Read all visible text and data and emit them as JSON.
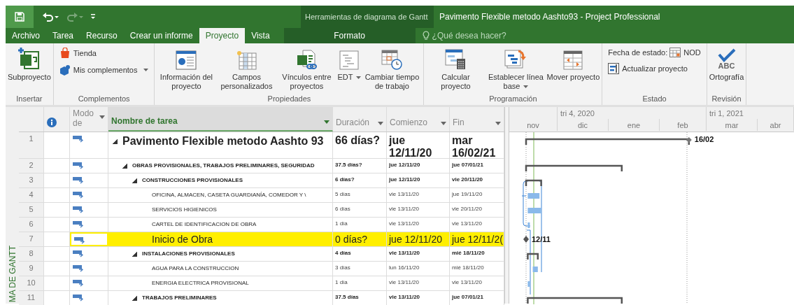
{
  "quick_access": [
    {
      "kind": "save",
      "disabled": false
    },
    {
      "kind": "undo",
      "disabled": false
    },
    {
      "kind": "redo",
      "disabled": true
    },
    {
      "kind": "customize",
      "disabled": false
    }
  ],
  "context_title": "Herramientas de diagrama de Gantt",
  "window": {
    "title": "Pavimento Flexible metodo Aashto93 - Project Professional"
  },
  "tabs": [
    {
      "label": "Archivo",
      "selected": false
    },
    {
      "label": "Tarea",
      "selected": false
    },
    {
      "label": "Recurso",
      "selected": false
    },
    {
      "label": "Crear un informe",
      "selected": false
    },
    {
      "label": "Proyecto",
      "selected": true
    },
    {
      "label": "Vista",
      "selected": false
    },
    {
      "label": "Formato",
      "selected": false,
      "kind": "contextual"
    }
  ],
  "tell_me": {
    "placeholder": "¿Qué desea hacer?"
  },
  "ribbon_groups": [
    {
      "label": "Insertar",
      "buttons": [
        {
          "kind": "large",
          "label": "Subproyecto"
        }
      ]
    },
    {
      "label": "Complementos",
      "buttons": [
        {
          "kind": "small",
          "label": "Tienda"
        },
        {
          "kind": "small",
          "label": "Mis complementos",
          "dropdown": true
        }
      ]
    },
    {
      "label": "Propiedades",
      "buttons": [
        {
          "kind": "large",
          "label": "Información del proyecto"
        },
        {
          "kind": "large",
          "label": "Campos personalizados"
        },
        {
          "kind": "large",
          "label": "Vínculos entre proyectos"
        },
        {
          "kind": "large",
          "label": "EDT",
          "dropdown": true
        },
        {
          "kind": "large",
          "label": "Cambiar tiempo de trabajo"
        }
      ]
    },
    {
      "label": "Programación",
      "buttons": [
        {
          "kind": "large",
          "label": "Calcular proyecto"
        },
        {
          "kind": "large",
          "label": "Establecer línea base",
          "dropdown": true
        },
        {
          "kind": "large",
          "label": "Mover proyecto"
        }
      ]
    },
    {
      "label": "Estado",
      "buttons": [
        {
          "kind": "status",
          "label": "Fecha de estado:",
          "value": "NOD"
        },
        {
          "kind": "small",
          "label": "Actualizar proyecto"
        }
      ]
    },
    {
      "label": "Revisión",
      "buttons": [
        {
          "kind": "large",
          "label": "Ortografía",
          "icon_text": "ABC"
        }
      ]
    }
  ],
  "side_label": "MA DE GANTT",
  "table": {
    "columns": [
      "Modo de",
      "Nombre de tarea",
      "Duración",
      "Comienzo",
      "Fin"
    ],
    "rows": [
      {
        "number": "1",
        "kind": "project",
        "name": "Pavimento Flexible metodo Aashto 93",
        "duration": "66 días?",
        "start": "jue 12/11/20",
        "finish": "mar 16/02/21",
        "highlight": false,
        "expanded": true,
        "bar_label": "16/02",
        "children": [
          {
            "number": "2",
            "kind": "summary",
            "name": "OBRAS PROVISIONALES, TRABAJOS PRELIMINARES, SEGURIDAD",
            "duration": "37.5 días?",
            "start": "jue 12/11/20",
            "finish": "jue 07/01/21",
            "highlight": false,
            "expanded": true,
            "children": [
              {
                "number": "3",
                "kind": "summary",
                "name": "CONSTRUCCIONES PROVISIONALES",
                "duration": "6 días?",
                "start": "jue 12/11/20",
                "finish": "vie 20/11/20",
                "highlight": false,
                "expanded": true,
                "children": [
                  {
                    "number": "4",
                    "kind": "task",
                    "name": "OFICINA, ALMACEN, CASETA GUARDIANÍA, COMEDOR Y \\",
                    "duration": "5 días",
                    "start": "vie 13/11/20",
                    "finish": "jue 19/11/20",
                    "highlight": false
                  },
                  {
                    "number": "5",
                    "kind": "task",
                    "name": "SERVICIOS HIGIENICOS",
                    "duration": "6 días",
                    "start": "vie 13/11/20",
                    "finish": "vie 20/11/20",
                    "highlight": false
                  },
                  {
                    "number": "6",
                    "kind": "task",
                    "name": "CARTEL DE IDENTIFICACION DE OBRA",
                    "duration": "1 día",
                    "start": "vie 13/11/20",
                    "finish": "vie 13/11/20",
                    "highlight": false
                  },
                  {
                    "number": "7",
                    "kind": "milestone",
                    "name": "Inicio de Obra",
                    "duration": "0 días?",
                    "start": "jue 12/11/20",
                    "finish": "jue 12/11/2(",
                    "highlight": true,
                    "bar_label": "12/11"
                  }
                ]
              },
              {
                "number": "8",
                "kind": "summary",
                "name": "INSTALACIONES PROVISIONALES",
                "duration": "4 días",
                "start": "vie 13/11/20",
                "finish": "mié 18/11/20",
                "highlight": false,
                "expanded": true,
                "children": [
                  {
                    "number": "9",
                    "kind": "task",
                    "name": "AGUA PARA LA CONSTRUCCION",
                    "duration": "3 días",
                    "start": "lun 16/11/20",
                    "finish": "mié 18/11/20",
                    "highlight": false
                  },
                  {
                    "number": "10",
                    "kind": "task",
                    "name": "ENERGIA ELECTRICA PROVISIONAL",
                    "duration": "1 día",
                    "start": "vie 13/11/20",
                    "finish": "vie 13/11/20",
                    "highlight": false
                  }
                ]
              },
              {
                "number": "11",
                "kind": "summary",
                "name": "TRABAJOS PRELIMINARES",
                "duration": "37.5 días",
                "start": "vie 13/11/20",
                "finish": "jue 07/01/21",
                "highlight": false,
                "expanded": true
              }
            ]
          }
        ]
      }
    ]
  },
  "timescale": {
    "quarters": [
      "tri 4, 2020",
      "tri 1, 2021"
    ],
    "months": [
      "nov",
      "dic",
      "ene",
      "feb",
      "mar",
      "abr"
    ]
  }
}
